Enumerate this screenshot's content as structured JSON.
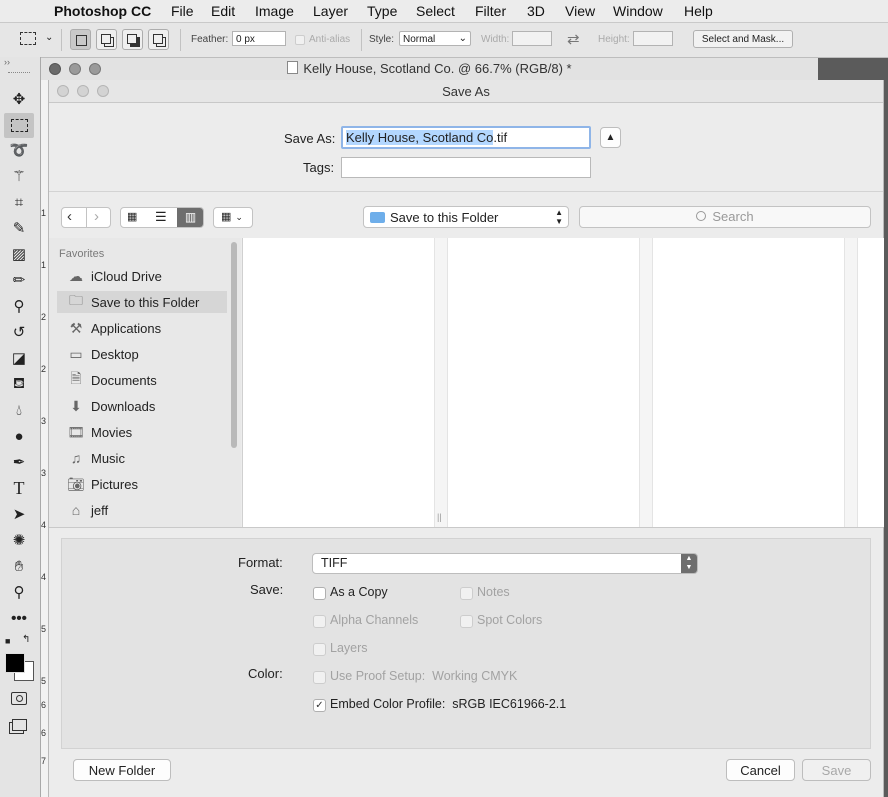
{
  "menubar": {
    "app_name": "Photoshop CC",
    "items": [
      "File",
      "Edit",
      "Image",
      "Layer",
      "Type",
      "Select",
      "Filter",
      "3D",
      "View",
      "Window",
      "Help"
    ]
  },
  "options_bar": {
    "feather_label": "Feather:",
    "feather_value": "0 px",
    "antialias_label": "Anti-alias",
    "style_label": "Style:",
    "style_value": "Normal",
    "width_label": "Width:",
    "height_label": "Height:",
    "select_mask_label": "Select and Mask..."
  },
  "document": {
    "title": "Kelly House, Scotland Co. @ 66.7% (RGB/8) *"
  },
  "ruler_numbers": [
    "1",
    "1",
    "2",
    "2",
    "3",
    "3",
    "4",
    "4",
    "5",
    "5",
    "6",
    "6",
    "7"
  ],
  "dialog": {
    "title": "Save As",
    "save_as_label": "Save As:",
    "filename_selected": "Kelly House, Scotland Co",
    "filename_ext": ".tif",
    "tags_label": "Tags:",
    "location_value": "Save to this Folder",
    "search_placeholder": "Search",
    "sidebar": {
      "section_label": "Favorites",
      "items": [
        {
          "label": "iCloud Drive",
          "icon": "cloud-icon"
        },
        {
          "label": "Save to this Folder",
          "icon": "folder-icon",
          "selected": true
        },
        {
          "label": "Applications",
          "icon": "applications-icon"
        },
        {
          "label": "Desktop",
          "icon": "desktop-icon"
        },
        {
          "label": "Documents",
          "icon": "documents-icon"
        },
        {
          "label": "Downloads",
          "icon": "downloads-icon"
        },
        {
          "label": "Movies",
          "icon": "movies-icon"
        },
        {
          "label": "Music",
          "icon": "music-icon"
        },
        {
          "label": "Pictures",
          "icon": "pictures-icon"
        },
        {
          "label": "jeff",
          "icon": "home-icon"
        }
      ]
    },
    "format_label": "Format:",
    "format_value": "TIFF",
    "save_label": "Save:",
    "color_label": "Color:",
    "options": {
      "as_a_copy": {
        "label": "As a Copy",
        "checked": false,
        "enabled": true
      },
      "notes": {
        "label": "Notes",
        "checked": false,
        "enabled": false
      },
      "alpha_channels": {
        "label": "Alpha Channels",
        "checked": false,
        "enabled": false
      },
      "spot_colors": {
        "label": "Spot Colors",
        "checked": false,
        "enabled": false
      },
      "layers": {
        "label": "Layers",
        "checked": false,
        "enabled": false
      },
      "use_proof_setup": {
        "label": "Use Proof Setup:  Working CMYK",
        "checked": false,
        "enabled": false
      },
      "embed_color_profile": {
        "label": "Embed Color Profile:  sRGB IEC61966-2.1",
        "checked": true,
        "enabled": true
      }
    },
    "new_folder_label": "New Folder",
    "cancel_label": "Cancel",
    "save_button_label": "Save"
  },
  "colors": {
    "selection_highlight": "#b3d7ff",
    "sidebar_selected": "#d9d9d9",
    "disabled_text": "#a2a2a2"
  }
}
